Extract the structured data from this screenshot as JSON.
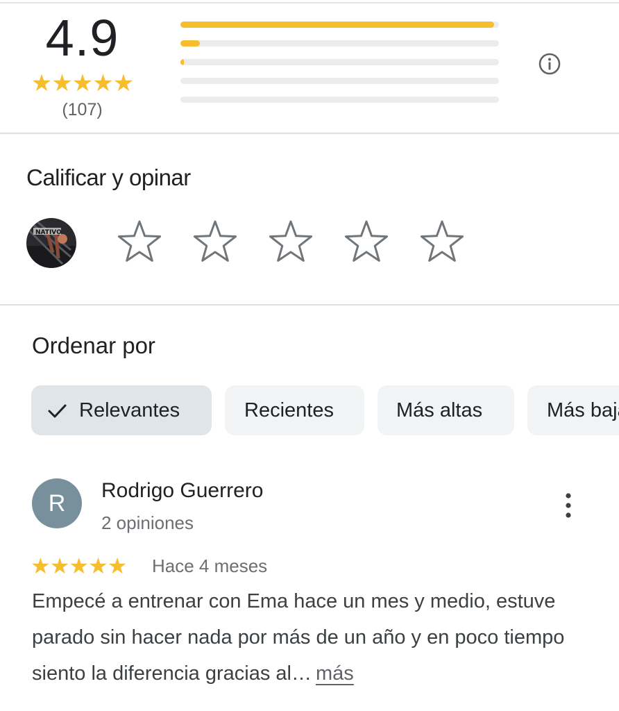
{
  "rating_summary": {
    "average": "4.9",
    "stars": "★★★★★",
    "count": "(107)",
    "distribution": [
      0.985,
      0.06,
      0.01,
      0.0,
      0.0
    ],
    "star_color": "#f6be2c",
    "info_icon": "info-icon"
  },
  "rate_review": {
    "title": "Calificar y opinar",
    "avatar_icon": "user-avatar-photo",
    "star_icon": "star-outline-icon"
  },
  "sort": {
    "title": "Ordenar por",
    "chips": [
      {
        "label": "Relevantes",
        "selected": true
      },
      {
        "label": "Recientes",
        "selected": false
      },
      {
        "label": "Más altas",
        "selected": false
      },
      {
        "label": "Más bajas",
        "selected": false
      }
    ]
  },
  "review": {
    "avatar_letter": "R",
    "avatar_color": "#78909c",
    "name": "Rodrigo Guerrero",
    "meta": "2 opiniones",
    "stars": "★★★★★",
    "time": "Hace 4 meses",
    "text": "Empecé a entrenar con Ema hace un mes y medio, estuve parado sin hacer nada por más de un año y en poco tiempo siento la diferencia gracias al…",
    "more": "más",
    "menu_icon": "more-vert-icon"
  }
}
